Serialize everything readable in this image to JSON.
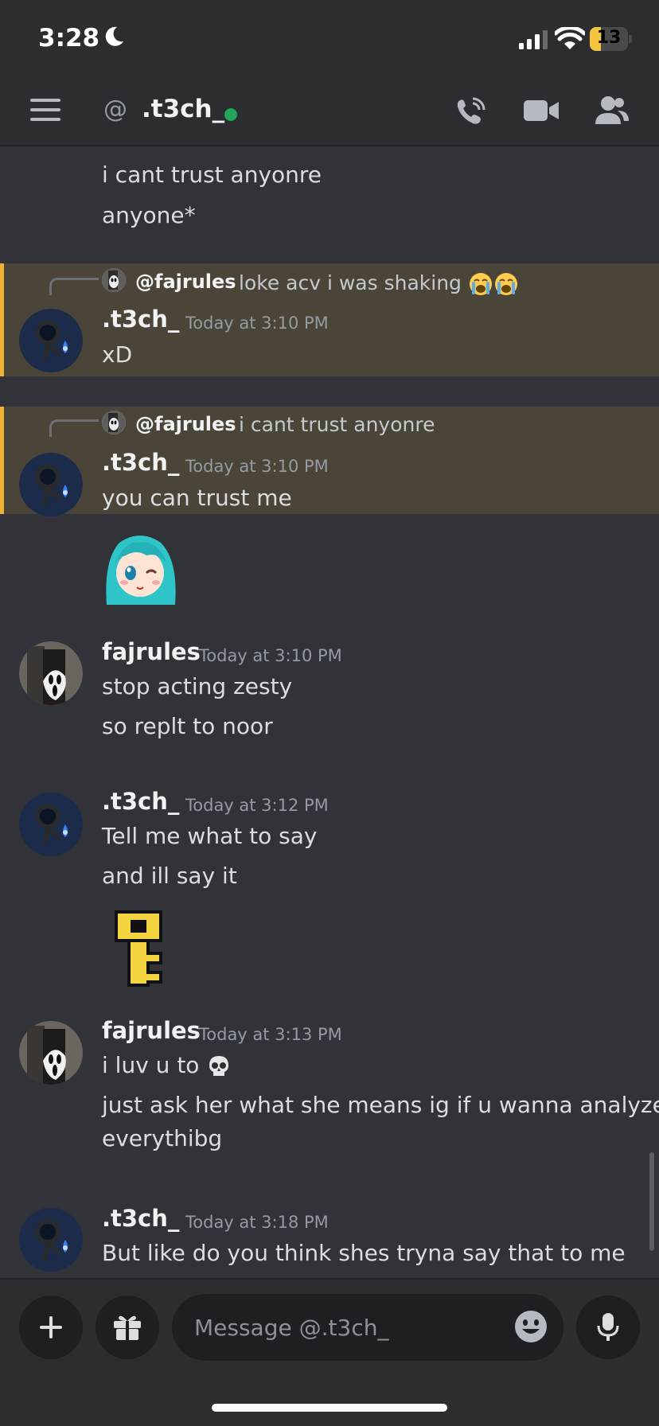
{
  "status_bar": {
    "time": "3:28",
    "battery": "13",
    "battery_level": 0.13
  },
  "header": {
    "channel": ".t3ch_",
    "at_symbol": "@",
    "status": "online"
  },
  "icons": {
    "menu": "hamburger-menu-icon",
    "call": "phone-call-icon",
    "video": "video-camera-icon",
    "members": "members-icon",
    "add": "plus-icon",
    "gift": "gift-icon",
    "emoji": "emoji-picker-icon",
    "mic": "microphone-icon",
    "cry_emoji": "loudly-crying-face",
    "skull_emoji": "skull"
  },
  "colors": {
    "accent_highlight": "#f0b232",
    "online": "#23a55a",
    "background": "#313338"
  },
  "messages": {
    "m0": {
      "lines": [
        "i cant trust anyonre",
        "anyone*"
      ]
    },
    "m1": {
      "reply": {
        "author": "@fajrules",
        "text": "loke acv i was shaking"
      },
      "author": ".t3ch_",
      "timestamp": "Today at 3:10 PM",
      "lines": [
        "xD"
      ]
    },
    "m2": {
      "reply": {
        "author": "@fajrules",
        "text": "i cant trust anyonre"
      },
      "author": ".t3ch_",
      "timestamp": "Today at 3:10 PM",
      "lines": [
        "you can trust me"
      ]
    },
    "m3": {
      "author": "fajrules",
      "timestamp": "Today at 3:10 PM",
      "lines": [
        "stop acting zesty",
        "so replt to noor"
      ]
    },
    "m4": {
      "author": ".t3ch_",
      "timestamp": "Today at 3:12 PM",
      "lines": [
        "Tell me what to say",
        "and ill say it"
      ]
    },
    "m5": {
      "author": "fajrules",
      "timestamp": "Today at 3:13 PM",
      "lines": [
        "i luv u to",
        "just ask her what she means ig if u wanna analyze",
        "everythibg"
      ]
    },
    "m6": {
      "author": ".t3ch_",
      "timestamp": "Today at 3:18 PM",
      "lines": [
        "But like do you think shes tryna say that to me"
      ]
    }
  },
  "composer": {
    "placeholder": "Message @.t3ch_"
  }
}
